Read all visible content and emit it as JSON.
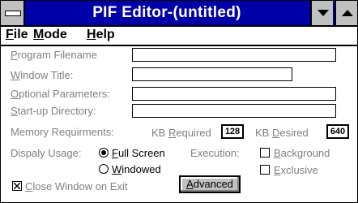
{
  "window": {
    "title": "PIF Editor-(untitled)"
  },
  "menubar": {
    "items": [
      {
        "key": "F",
        "rest": "ile"
      },
      {
        "key": "M",
        "rest": "ode"
      },
      {
        "key": "H",
        "rest": "elp"
      }
    ]
  },
  "form": {
    "program_filename": {
      "pre": "",
      "key": "P",
      "post": "rogram Filename",
      "value": ""
    },
    "window_title": {
      "pre": "",
      "key": "W",
      "post": "indow Title:",
      "value": ""
    },
    "optional_parameters": {
      "pre": "",
      "key": "O",
      "post": "ptional Parameters:",
      "value": ""
    },
    "startup_directory": {
      "pre": "",
      "key": "S",
      "post": "tart-up Directory:",
      "value": ""
    },
    "memory": {
      "label": "Memory Requirments:",
      "kb_required_pre": "KB ",
      "kb_required_key": "R",
      "kb_required_post": "equired",
      "kb_required_value": "128",
      "kb_desired_pre": "KB ",
      "kb_desired_key": "D",
      "kb_desired_post": "esired",
      "kb_desired_value": "640"
    },
    "display_usage": {
      "label": "Dispaly Usage:",
      "full_screen": {
        "pre": "",
        "key": "F",
        "post": "ull Screen",
        "selected": true
      },
      "windowed": {
        "pre": "",
        "key": "W",
        "post": "indowed",
        "selected": false
      }
    },
    "execution": {
      "label": "Execution:",
      "background": {
        "pre": "",
        "key": "B",
        "post": "ackground",
        "checked": false
      },
      "exclusive": {
        "pre": "",
        "key": "E",
        "post": "xclusive",
        "checked": false
      }
    },
    "close_window_on_exit": {
      "pre": "",
      "key": "C",
      "post": "lose Window on Exit",
      "checked": true
    },
    "advanced_button": {
      "pre": "",
      "key": "A",
      "post": "dvanced"
    }
  }
}
